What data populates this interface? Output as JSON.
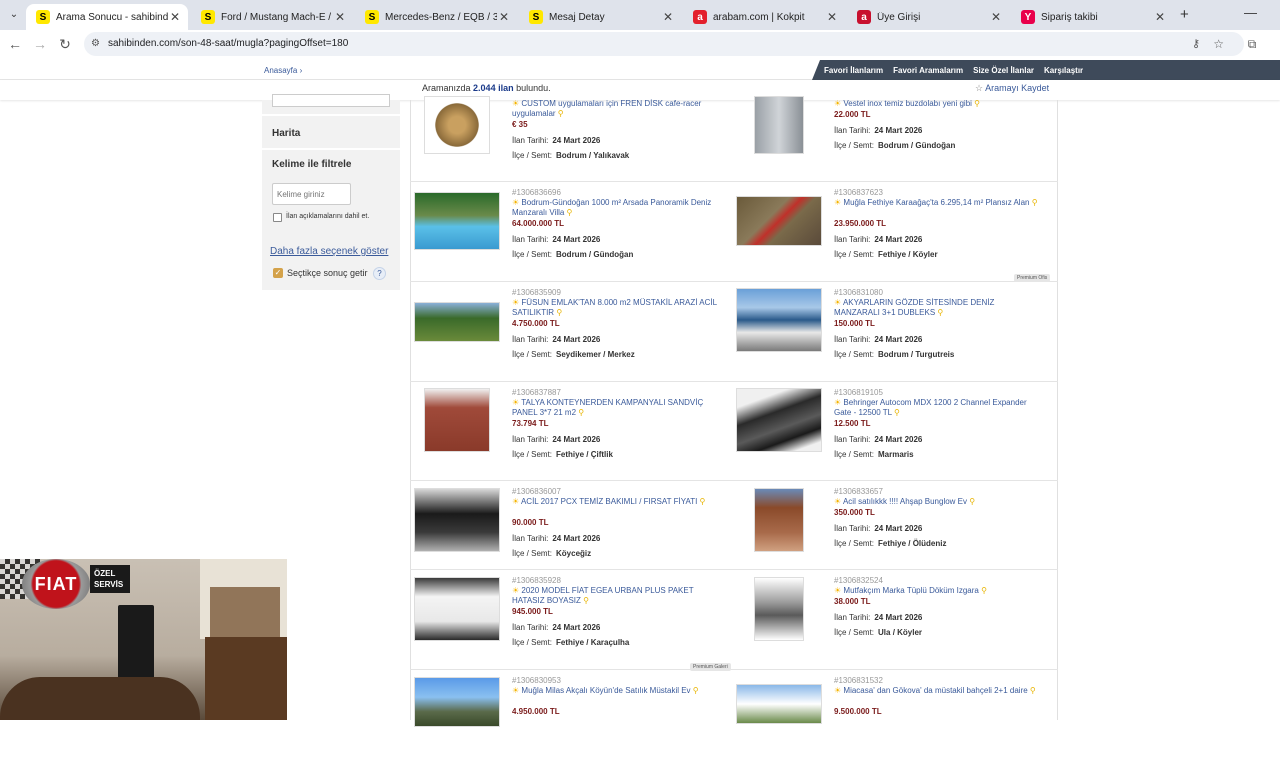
{
  "browser": {
    "tabs": [
      {
        "title": "Arama Sonucu - sahibinden.com",
        "icon_color": "#ffe800",
        "icon_letter": "S",
        "active": true
      },
      {
        "title": "Ford / Mustang Mach-E / Prem",
        "icon_color": "#ffe800",
        "icon_letter": "S",
        "active": false
      },
      {
        "title": "Mercedes-Benz / EQB / 350 / E",
        "icon_color": "#ffe800",
        "icon_letter": "S",
        "active": false
      },
      {
        "title": "Mesaj Detay",
        "icon_color": "#ffe800",
        "icon_letter": "S",
        "active": false
      },
      {
        "title": "arabam.com | Kokpit",
        "icon_color": "#e3202c",
        "icon_letter": "a",
        "active": false
      },
      {
        "title": "Üye Girişi",
        "icon_color": "#c8102e",
        "icon_letter": "a",
        "active": false
      },
      {
        "title": "Sipariş takibi",
        "icon_color": "#e9004b",
        "icon_letter": "Y",
        "active": false
      }
    ],
    "url": "sahibinden.com/son-48-saat/mugla?pagingOffset=180"
  },
  "page": {
    "breadcrumb": "Anasayfa",
    "nav_links": [
      "Favori İlanlarım",
      "Favori Aramalarım",
      "Size Özel İlanlar",
      "Karşılaştır"
    ],
    "found_prefix": "Aramanızda",
    "found_count": "2.044 ilan",
    "found_suffix": "bulundu.",
    "save_search": "Aramayı Kaydet"
  },
  "sidebar": {
    "map_label": "Harita",
    "keyword_title": "Kelime ile filtrele",
    "keyword_placeholder": "Kelime giriniz",
    "include_desc_label": "İlan açıklamalarını dahil et.",
    "include_desc_checked": false,
    "more_options": "Daha fazla seçenek göster",
    "auto_results_label": "Seçtikçe sonuç getir",
    "auto_results_checked": true,
    "help": "?"
  },
  "labels": {
    "date_label": "İlan Tarihi:",
    "loc_label": "İlçe / Semt:"
  },
  "listings": [
    {
      "id": "",
      "title": "CUSTOM uygulamaları için FREN DİSK cafe-racer uygulamalar",
      "price": "€ 35",
      "date": "24 Mart 2026",
      "loc": "Bodrum / Yalıkavak"
    },
    {
      "id": "",
      "title": "Vestel inox temiz buzdolabı yeni gibi",
      "price": "22.000 TL",
      "date": "24 Mart 2026",
      "loc": "Bodrum / Gündoğan"
    },
    {
      "id": "#1306836696",
      "title": "Bodrum-Gündoğan 1000 m² Arsada Panoramik Deniz Manzaralı Villa",
      "price": "64.000.000 TL",
      "date": "24 Mart 2026",
      "loc": "Bodrum / Gündoğan"
    },
    {
      "id": "#1306837623",
      "title": "Muğla Fethiye Karaağaç'ta 6.295,14 m² Plansız Alan",
      "price": "23.950.000 TL",
      "date": "24 Mart 2026",
      "loc": "Fethiye / Köyler",
      "badge": "Premium Ofis"
    },
    {
      "id": "#1306835909",
      "title": "FÜSUN EMLAK'TAN 8.000 m2 MÜSTAKİL ARAZİ ACİL SATILIKTIR",
      "price": "4.750.000 TL",
      "date": "24 Mart 2026",
      "loc": "Seydikemer / Merkez"
    },
    {
      "id": "#1306831080",
      "title": "AKYARLARIN GÖZDE SİTESİNDE DENİZ MANZARALI 3+1 DUBLEKS",
      "price": "150.000 TL",
      "date": "24 Mart 2026",
      "loc": "Bodrum / Turgutreis"
    },
    {
      "id": "#1306837887",
      "title": "TALYA KONTEYNERDEN KAMPANYALI SANDVİÇ PANEL 3*7 21 m2",
      "price": "73.794 TL",
      "date": "24 Mart 2026",
      "loc": "Fethiye / Çiftlik"
    },
    {
      "id": "#1306819105",
      "title": "Behringer Autocom MDX 1200 2 Channel Expander Gate - 12500 TL",
      "price": "12.500 TL",
      "date": "24 Mart 2026",
      "loc": "Marmaris"
    },
    {
      "id": "#1306836007",
      "title": "ACİL 2017 PCX TEMİZ BAKIMLI / FIRSAT FİYATI",
      "price": "90.000 TL",
      "date": "24 Mart 2026",
      "loc": "Köyceğiz"
    },
    {
      "id": "#1306833657",
      "title": "Acil satılıkkk !!!! Ahşap Bunglow Ev",
      "price": "350.000 TL",
      "date": "24 Mart 2026",
      "loc": "Fethiye / Ölüdeniz"
    },
    {
      "id": "#1306835928",
      "title": "2020 MODEL FİAT EGEA URBAN PLUS PAKET HATASIZ BOYASIZ",
      "price": "945.000 TL",
      "date": "24 Mart 2026",
      "loc": "Fethiye / Karaçulha",
      "badge": "Premium Galeri"
    },
    {
      "id": "#1306832524",
      "title": "Mutfakçım Marka Tüplü Döküm Izgara",
      "price": "38.000 TL",
      "date": "24 Mart 2026",
      "loc": "Ula / Köyler"
    },
    {
      "id": "#1306830953",
      "title": "Muğla Milas Akçalı Köyün'de Satılık Müstakil Ev",
      "price": "4.950.000 TL",
      "date": "",
      "loc": ""
    },
    {
      "id": "#1306831532",
      "title": "Miacasa' dan Gökova' da müstakil bahçeli 2+1 daire",
      "price": "9.500.000 TL",
      "date": "",
      "loc": ""
    }
  ],
  "webcam": {
    "logo_text": "FIAT",
    "sign_line1": "ÖZEL",
    "sign_line2": "SERVİS"
  },
  "colors": {
    "accent_blue": "#3a5a9a",
    "price_red": "#7a1a1a",
    "dark_nav": "#3e4a5a",
    "sahibinden_yellow": "#ffe800"
  }
}
